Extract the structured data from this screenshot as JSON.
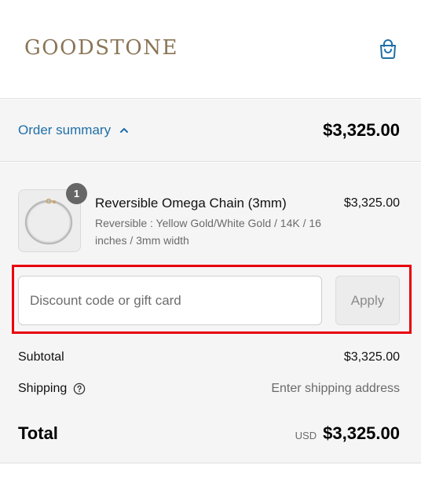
{
  "header": {
    "logo_text": "GOODSTONE",
    "cart_icon": "shopping-bag-icon"
  },
  "summary_bar": {
    "toggle_label": "Order summary",
    "toggle_icon": "chevron-up-icon",
    "total": "$3,325.00"
  },
  "line_item": {
    "quantity": "1",
    "name": "Reversible Omega Chain (3mm)",
    "variant": "Reversible : Yellow Gold/White Gold / 14K / 16 inches / 3mm width",
    "price": "$3,325.00",
    "image_icon": "chain-necklace-image"
  },
  "discount": {
    "placeholder": "Discount code or gift card",
    "value": "",
    "apply_label": "Apply"
  },
  "totals": {
    "subtotal_label": "Subtotal",
    "subtotal_value": "$3,325.00",
    "shipping_label": "Shipping",
    "shipping_help_icon": "question-circle-icon",
    "shipping_value": "Enter shipping address",
    "total_label": "Total",
    "currency": "USD",
    "total_value": "$3,325.00"
  },
  "colors": {
    "link_blue": "#1f6fa8",
    "logo_gold": "#8a7556",
    "highlight_red": "#e8000b",
    "panel_bg": "#f5f5f5"
  }
}
